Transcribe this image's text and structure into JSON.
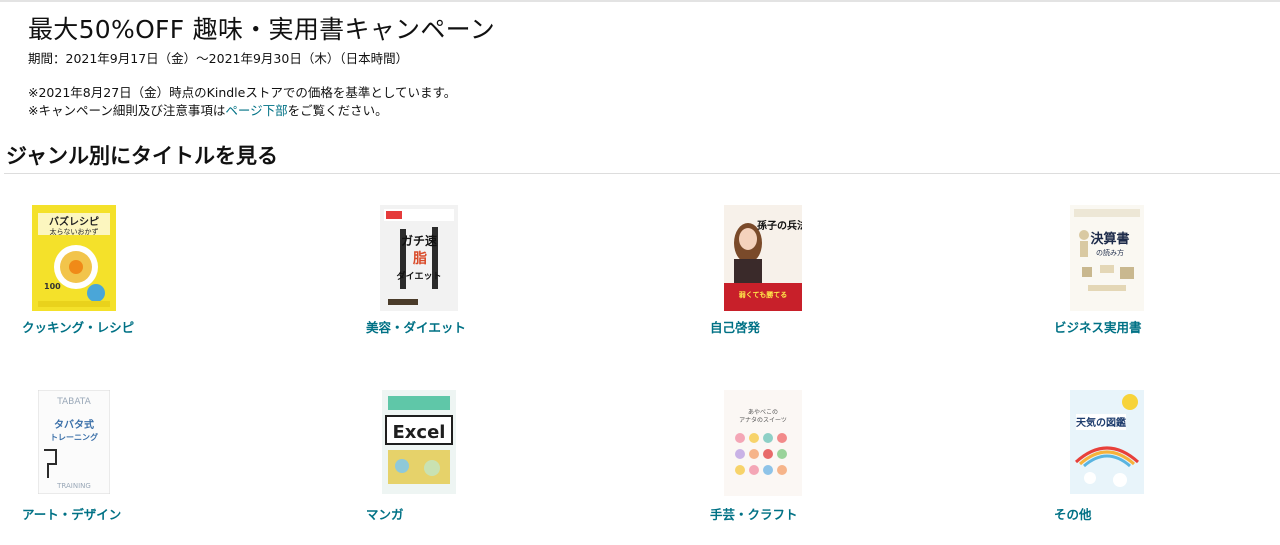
{
  "campaign": {
    "title": "最大50%OFF 趣味・実用書キャンペーン",
    "period": "期間：2021年9月17日（金）〜2021年9月30日（木）（日本時間）",
    "note1": "※2021年8月27日（金）時点のKindleストアでの価格を基準としています。",
    "note2_prefix": "※キャンペーン細則及び注意事項は",
    "note2_link": "ページ下部",
    "note2_suffix": "をご覧ください。"
  },
  "section": {
    "title": "ジャンル別にタイトルを見る"
  },
  "genres": [
    {
      "label": "クッキング・レシピ",
      "cover_text": [
        "バズレシピ",
        "太らないおかず",
        "100"
      ]
    },
    {
      "label": "美容・ダイエット",
      "cover_text": [
        "ガチ速",
        "脂",
        "ダイエット"
      ]
    },
    {
      "label": "自己啓発",
      "cover_text": [
        "孫子の兵法",
        "弱くても勝てる"
      ]
    },
    {
      "label": "ビジネス実用書",
      "cover_text": [
        "決算書",
        "の読み方"
      ]
    },
    {
      "label": "アート・デザイン",
      "cover_text": [
        "タバタ式",
        "トレーニング",
        "TRAINING"
      ]
    },
    {
      "label": "マンガ",
      "cover_text": [
        "Excel"
      ]
    },
    {
      "label": "手芸・クラフト",
      "cover_text": [
        "あやべこの",
        "アナタのスイーツ"
      ]
    },
    {
      "label": "その他",
      "cover_text": [
        "天気の図鑑"
      ]
    }
  ],
  "colors": {
    "link": "#007185",
    "text": "#111111"
  }
}
